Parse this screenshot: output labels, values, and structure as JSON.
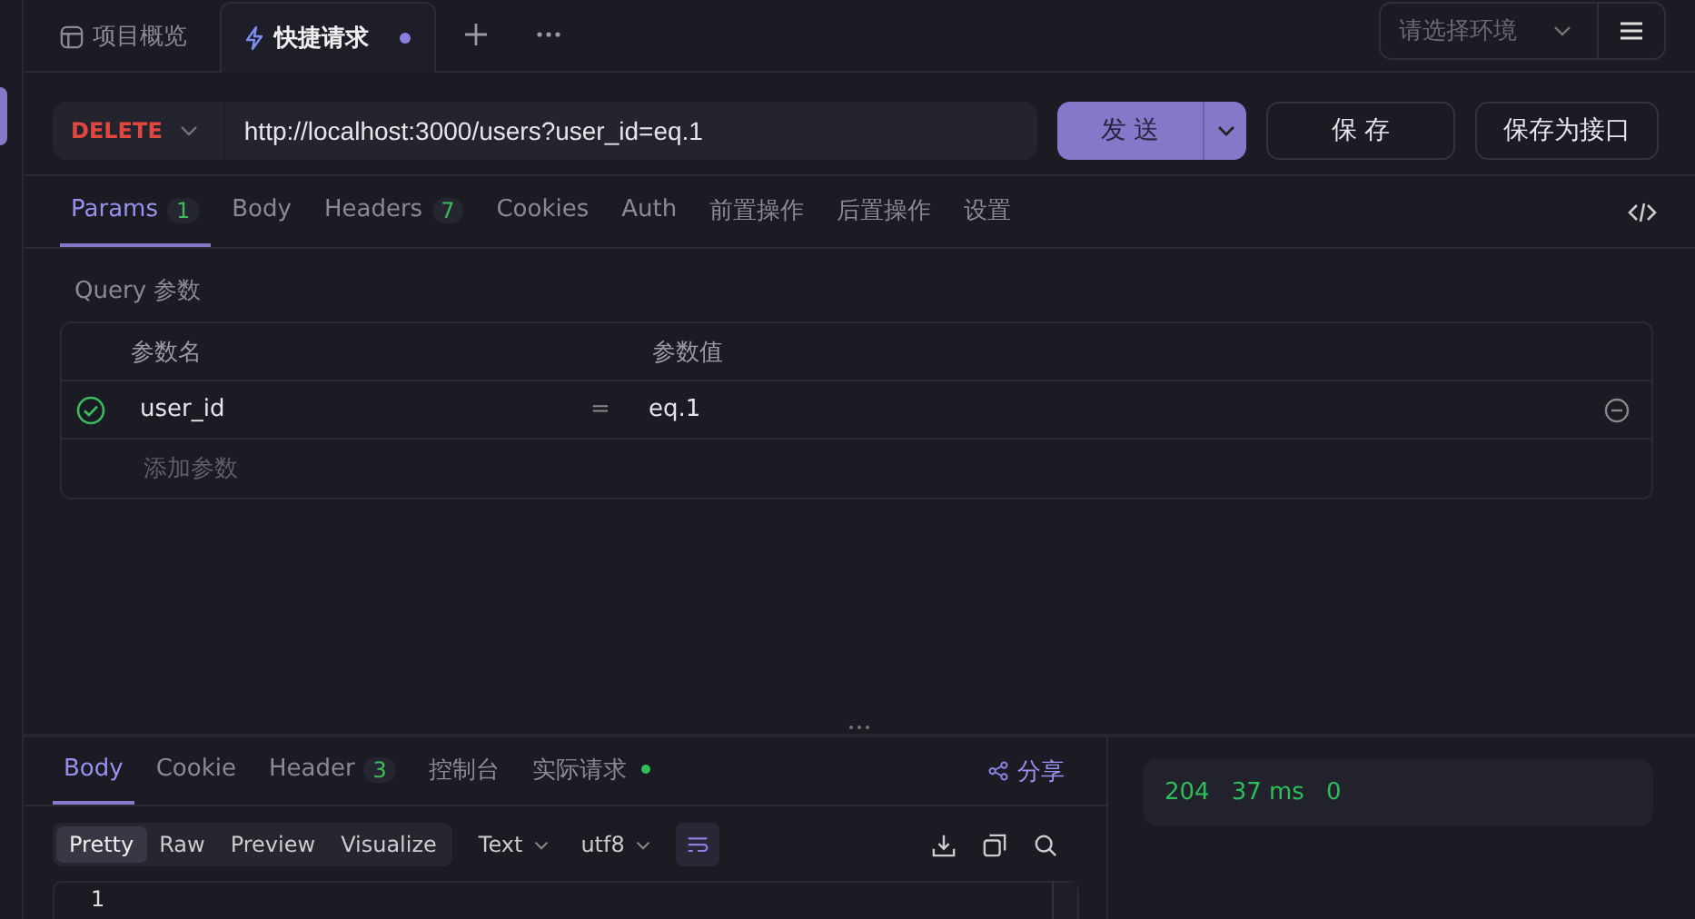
{
  "top_tabs": [
    {
      "kind": "overview",
      "label": "项目概览",
      "selected": false,
      "unsaved": false
    },
    {
      "kind": "quick",
      "label": "快捷请求",
      "selected": true,
      "unsaved": true
    }
  ],
  "environment": {
    "placeholder": "请选择环境"
  },
  "request": {
    "method": "DELETE",
    "url": "http://localhost:3000/users?user_id=eq.1"
  },
  "buttons": {
    "send": "发 送",
    "save": "保 存",
    "save_as": "保存为接口"
  },
  "request_tabs": [
    {
      "label": "Params",
      "count": "1",
      "selected": true
    },
    {
      "label": "Body",
      "selected": false
    },
    {
      "label": "Headers",
      "count": "7",
      "selected": false
    },
    {
      "label": "Cookies",
      "selected": false
    },
    {
      "label": "Auth",
      "selected": false
    },
    {
      "label": "前置操作",
      "selected": false
    },
    {
      "label": "后置操作",
      "selected": false
    },
    {
      "label": "设置",
      "selected": false
    }
  ],
  "query": {
    "title": "Query 参数",
    "columns": [
      "参数名",
      "参数值"
    ],
    "rows": [
      {
        "enabled": true,
        "name": "user_id",
        "operator": "=",
        "value": "eq.1"
      }
    ],
    "add_placeholder": "添加参数"
  },
  "response_tabs": [
    {
      "label": "Body",
      "selected": true,
      "indicator": false
    },
    {
      "label": "Cookie",
      "selected": false,
      "indicator": false
    },
    {
      "label": "Header",
      "count": "3",
      "selected": false,
      "indicator": false
    },
    {
      "label": "控制台",
      "selected": false,
      "indicator": false
    },
    {
      "label": "实际请求",
      "selected": false,
      "indicator": true
    }
  ],
  "share": "分享",
  "view_modes": [
    {
      "label": "Pretty",
      "selected": true
    },
    {
      "label": "Raw",
      "selected": false
    },
    {
      "label": "Preview",
      "selected": false
    },
    {
      "label": "Visualize",
      "selected": false
    }
  ],
  "format": "Text",
  "encoding": "utf8",
  "wrap_lines": true,
  "line_numbers": [
    "1"
  ],
  "status": {
    "code": "204",
    "time": "37 ms",
    "size": "0"
  }
}
